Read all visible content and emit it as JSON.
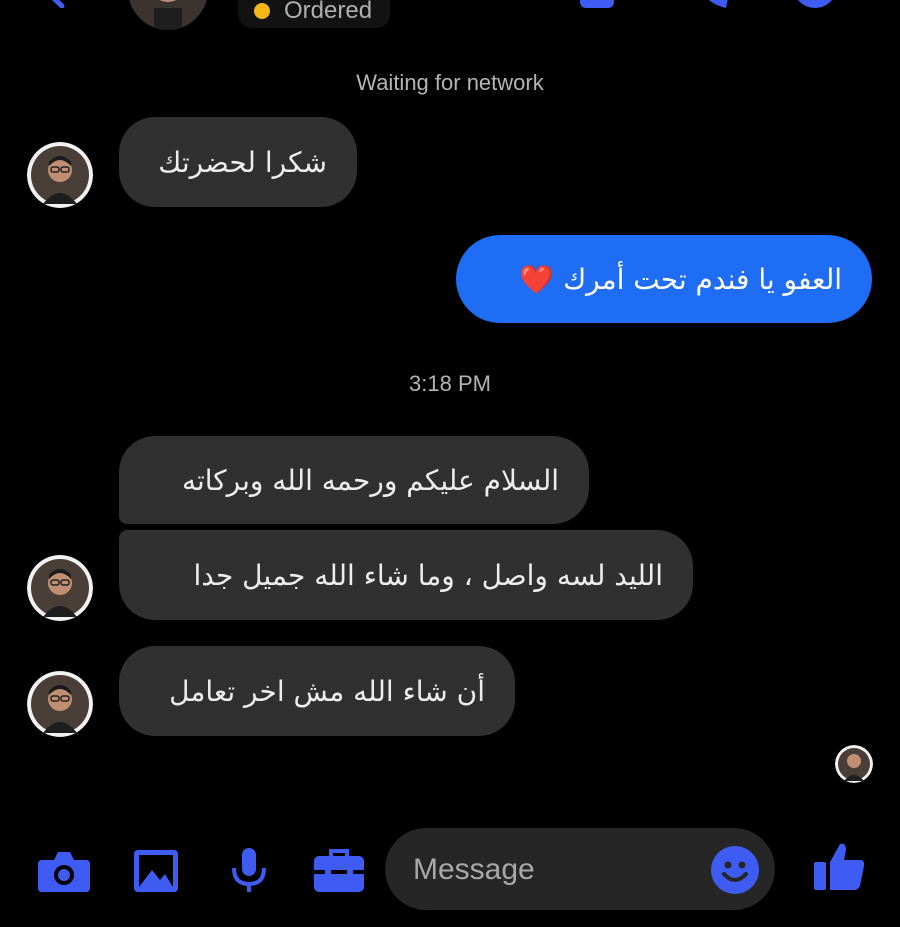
{
  "header": {
    "status_text": "Ordered",
    "status_dot_color": "#f5b915",
    "icons": [
      "back-icon",
      "video-icon",
      "phone-icon",
      "info-icon"
    ]
  },
  "conversation": {
    "network_notice": "Waiting for network",
    "timestamp": "3:18 PM",
    "messages": [
      {
        "side": "incoming",
        "text": "شكرا لحضرتك"
      },
      {
        "side": "outgoing",
        "text": "العفو يا فندم تحت أمرك ❤️"
      },
      {
        "side": "incoming",
        "text": "السلام عليكم ورحمه الله وبركاته"
      },
      {
        "side": "incoming",
        "text": "الليد لسه واصل ، وما شاء الله جميل جدا"
      },
      {
        "side": "incoming",
        "text": "أن شاء الله مش اخر تعامل"
      }
    ]
  },
  "composer": {
    "placeholder": "Message",
    "icons": [
      "camera-icon",
      "gallery-icon",
      "microphone-icon",
      "toolbox-icon",
      "emoji-icon",
      "thumbs-up-icon"
    ]
  },
  "colors": {
    "accent": "#1f6cf5",
    "icon_blue": "#3f5cf2",
    "incoming_bubble": "#303030",
    "background": "#000000"
  }
}
